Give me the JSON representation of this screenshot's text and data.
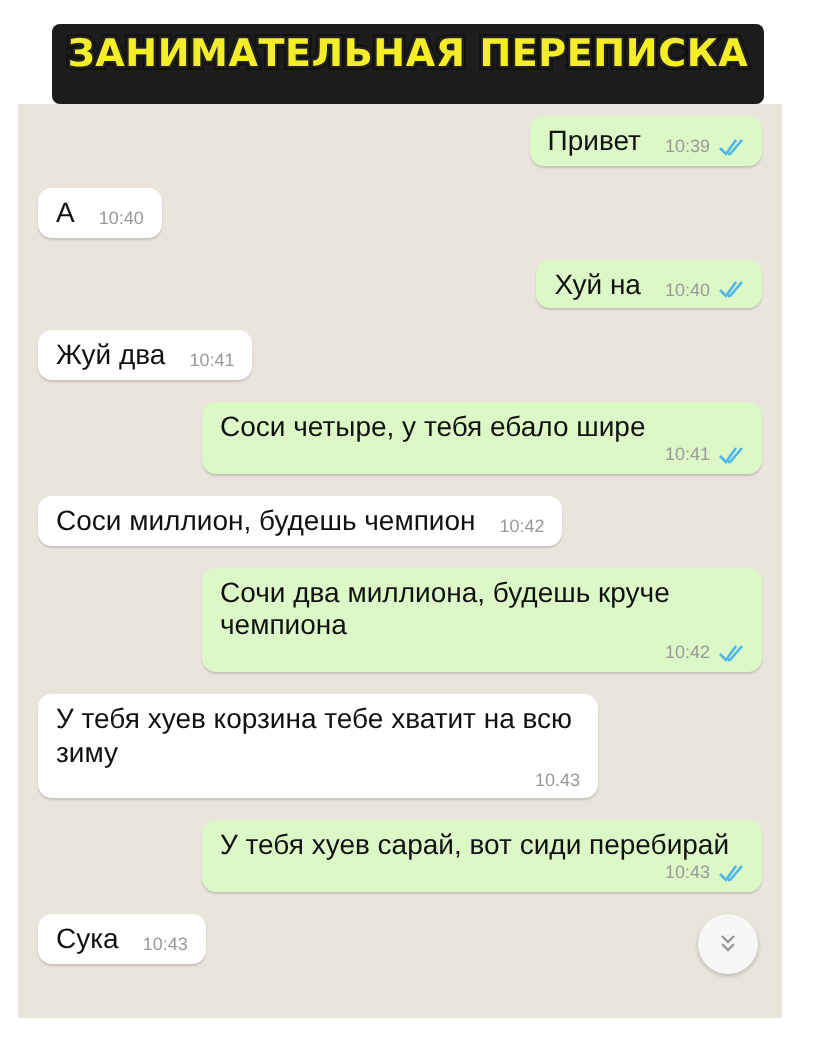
{
  "title": "ЗАНИМАТЕЛЬНАЯ ПЕРЕПИСКА",
  "messages": [
    {
      "kind": "outgoing",
      "text": "Привет",
      "time": "10:39",
      "read": true
    },
    {
      "kind": "incoming",
      "text": "А",
      "time": "10:40"
    },
    {
      "kind": "outgoing",
      "text": "Хуй на",
      "time": "10:40",
      "read": true
    },
    {
      "kind": "incoming",
      "text": "Жуй два",
      "time": "10:41"
    },
    {
      "kind": "outgoing",
      "text": "Соси четыре, у тебя ебало шире",
      "time": "10:41",
      "read": true
    },
    {
      "kind": "incoming",
      "text": "Соси миллион, будешь чемпион",
      "time": "10:42"
    },
    {
      "kind": "outgoing",
      "text": "Сочи два миллиона, будешь круче чемпиона",
      "time": "10:42",
      "read": true
    },
    {
      "kind": "incoming",
      "text": "У тебя хуев корзина тебе хватит на всю зиму",
      "time": "10.43"
    },
    {
      "kind": "outgoing",
      "text": "У тебя хуев сарай, вот сиди перебирай",
      "time": "10:43",
      "read": true
    },
    {
      "kind": "incoming",
      "text": "Сука",
      "time": "10:43"
    }
  ]
}
